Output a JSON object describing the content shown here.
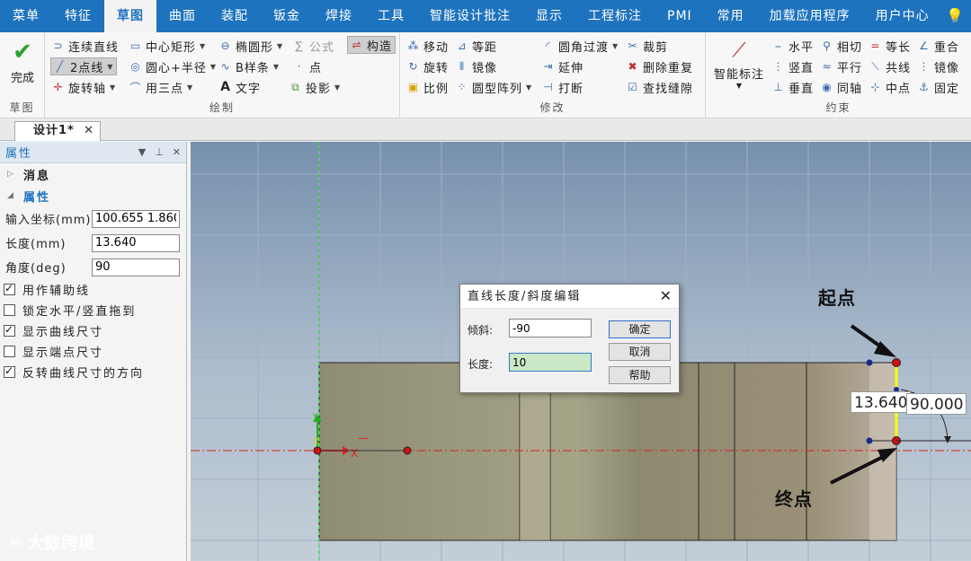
{
  "menubar": {
    "items": [
      "菜单",
      "特征",
      "草图",
      "曲面",
      "装配",
      "钣金",
      "焊接",
      "工具",
      "智能设计批注",
      "显示",
      "工程标注",
      "PMI",
      "常用",
      "加载应用程序",
      "用户中心"
    ],
    "active_index": 2
  },
  "ribbon": {
    "finish": {
      "label": "完成",
      "group": "草图"
    },
    "draw": {
      "group": "绘制",
      "items": [
        "连续直线",
        "中心矩形",
        "椭圆形",
        "公式",
        "构造",
        "2点线",
        "圆心+半径",
        "B样条",
        "点",
        "旋转轴",
        "用三点",
        "文字",
        "投影"
      ]
    },
    "modify": {
      "group": "修改",
      "items": [
        "移动",
        "等距",
        "圆角过渡",
        "裁剪",
        "旋转",
        "镜像",
        "延伸",
        "删除重复",
        "比例",
        "圆型阵列",
        "打断",
        "查找缝隙"
      ]
    },
    "constrain": {
      "group": "约束",
      "smart": "智能标注",
      "items": [
        "水平",
        "相切",
        "等长",
        "重合",
        "竖直",
        "平行",
        "共线",
        "镜像",
        "垂直",
        "同轴",
        "中点",
        "固定"
      ]
    }
  },
  "doc_tab": {
    "label": "设计1*"
  },
  "panel": {
    "title": "属性",
    "section_info": "消息",
    "section_props": "属性",
    "fields": [
      {
        "label": "输入坐标(mm)",
        "value": "100.655 1.860"
      },
      {
        "label": "长度(mm)",
        "value": "13.640"
      },
      {
        "label": "角度(deg)",
        "value": "90"
      }
    ],
    "checks": [
      {
        "label": "用作辅助线",
        "checked": true
      },
      {
        "label": "锁定水平/竖直拖到",
        "checked": false
      },
      {
        "label": "显示曲线尺寸",
        "checked": true
      },
      {
        "label": "显示端点尺寸",
        "checked": false
      },
      {
        "label": "反转曲线尺寸的方向",
        "checked": true
      }
    ]
  },
  "dialog": {
    "title": "直线长度/斜度编辑",
    "slope_label": "倾斜:",
    "slope_value": "-90",
    "length_label": "长度:",
    "length_value": "10",
    "ok": "确定",
    "cancel": "取消",
    "help": "帮助"
  },
  "canvas": {
    "start_label": "起点",
    "end_label": "终点",
    "dim_length": "13.640",
    "dim_angle": "90.000",
    "axis_x": "X",
    "axis_y": "Y",
    "axis_z": "Z"
  },
  "watermark": "大数跨境",
  "colors": {
    "accent": "#1e73be",
    "line_selected": "#ffff00",
    "point": "#d01010"
  }
}
